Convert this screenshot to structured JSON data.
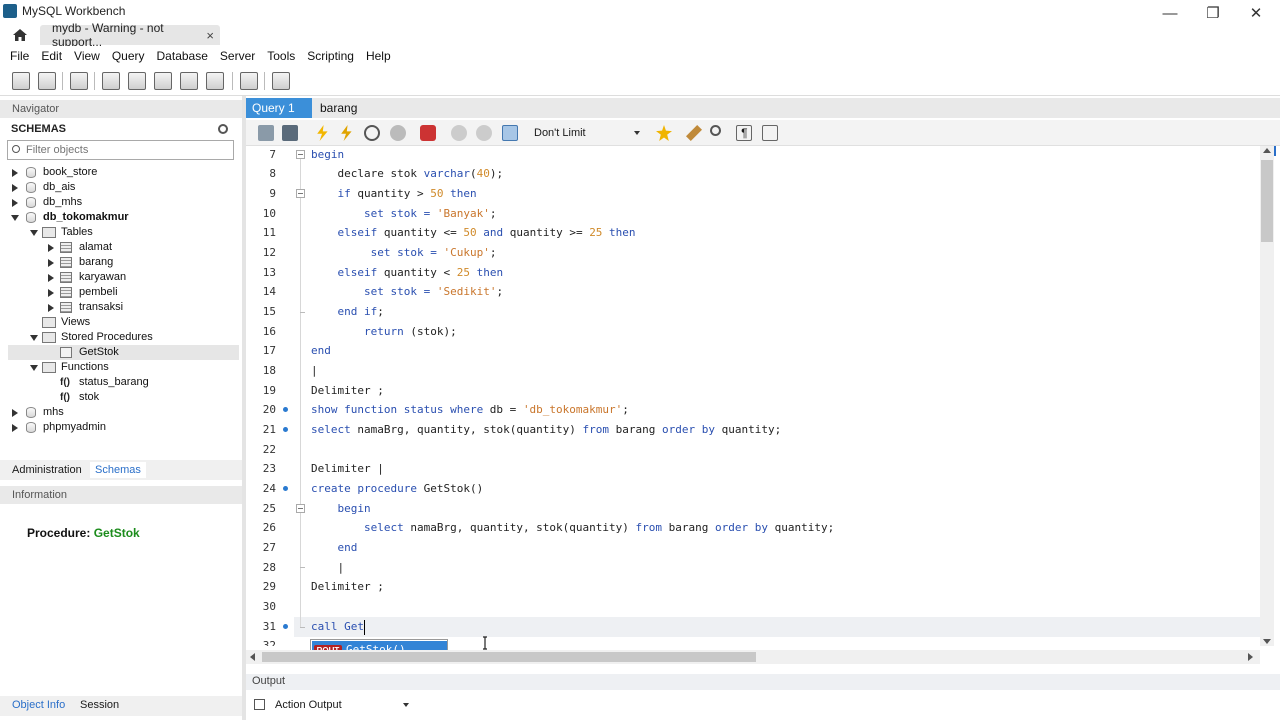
{
  "window": {
    "title": "MySQL Workbench",
    "connection_tab": "mydb - Warning - not support...",
    "minimize": "—",
    "maximize": "❐",
    "close": "✕"
  },
  "menu": [
    "File",
    "Edit",
    "View",
    "Query",
    "Database",
    "Server",
    "Tools",
    "Scripting",
    "Help"
  ],
  "navigator": {
    "header": "Navigator",
    "schemas_title": "SCHEMAS",
    "filter_placeholder": "Filter objects",
    "tree": {
      "book_store": "book_store",
      "db_ais": "db_ais",
      "db_mhs": "db_mhs",
      "db_tokomakmur": "db_tokomakmur",
      "tables": "Tables",
      "alamat": "alamat",
      "barang": "barang",
      "karyawan": "karyawan",
      "pembeli": "pembeli",
      "transaksi": "transaksi",
      "views": "Views",
      "stored_procedures": "Stored Procedures",
      "getstok": "GetStok",
      "functions": "Functions",
      "status_barang": "status_barang",
      "stok": "stok",
      "mhs": "mhs",
      "phpmyadmin": "phpmyadmin",
      "fn_glyph": "f()"
    },
    "tabs": {
      "administration": "Administration",
      "schemas": "Schemas"
    },
    "info_header": "Information",
    "procedure_label": "Procedure:",
    "procedure_name": "GetStok",
    "bottom_tabs": {
      "object_info": "Object Info",
      "session": "Session"
    }
  },
  "editor": {
    "tabs": {
      "query1": "Query 1",
      "barang": "barang"
    },
    "limit": "Don't Limit",
    "lines": {
      "l7": "begin",
      "l8a": "    declare stok ",
      "l8b": "varchar",
      "l8c": "(",
      "l8d": "40",
      "l8e": ");",
      "l9a": "    ",
      "l9b": "if",
      "l9c": " quantity > ",
      "l9d": "50",
      "l9e": " then",
      "l10a": "        set stok = ",
      "l10b": "'Banyak'",
      "l10c": ";",
      "l11a": "    ",
      "l11b": "elseif",
      "l11c": " quantity <= ",
      "l11d": "50",
      "l11e": " and",
      "l11f": " quantity >= ",
      "l11g": "25",
      "l11h": " then",
      "l12a": "         set stok = ",
      "l12b": "'Cukup'",
      "l12c": ";",
      "l13a": "    ",
      "l13b": "elseif",
      "l13c": " quantity < ",
      "l13d": "25",
      "l13e": " then",
      "l14a": "        set stok = ",
      "l14b": "'Sedikit'",
      "l14c": ";",
      "l15a": "    ",
      "l15b": "end if",
      "l15c": ";",
      "l16a": "        ",
      "l16b": "return",
      "l16c": " (stok);",
      "l17": "end",
      "l18": "|",
      "l19": "Delimiter ;",
      "l20a": "show function status where",
      "l20b": " db = ",
      "l20c": "'db_tokomakmur'",
      "l20d": ";",
      "l21a": "select",
      "l21b": " namaBrg, quantity, stok(quantity) ",
      "l21c": "from",
      "l21d": " barang ",
      "l21e": "order by",
      "l21f": " quantity;",
      "l23": "Delimiter |",
      "l24a": "create procedure",
      "l24b": " GetStok()",
      "l25": "    begin",
      "l26a": "        ",
      "l26b": "select",
      "l26c": " namaBrg, quantity, stok(quantity) ",
      "l26d": "from",
      "l26e": " barang ",
      "l26f": "order by",
      "l26g": " quantity;",
      "l27": "    end",
      "l28": "    |",
      "l29": "Delimiter ;",
      "l31a": "call",
      "l31b": " Get"
    },
    "line_numbers": [
      "7",
      "8",
      "9",
      "10",
      "11",
      "12",
      "13",
      "14",
      "15",
      "16",
      "17",
      "18",
      "19",
      "20",
      "21",
      "22",
      "23",
      "24",
      "25",
      "26",
      "27",
      "28",
      "29",
      "30",
      "31",
      "32"
    ],
    "autocomplete": {
      "badge": "ROUT",
      "item": "GetStok()"
    }
  },
  "output": {
    "header": "Output",
    "selector": "Action Output"
  },
  "colors": {
    "keyword": "#2a4fb0",
    "number": "#d08a2a",
    "string": "#c9762c",
    "accent": "#3b8fd9"
  }
}
